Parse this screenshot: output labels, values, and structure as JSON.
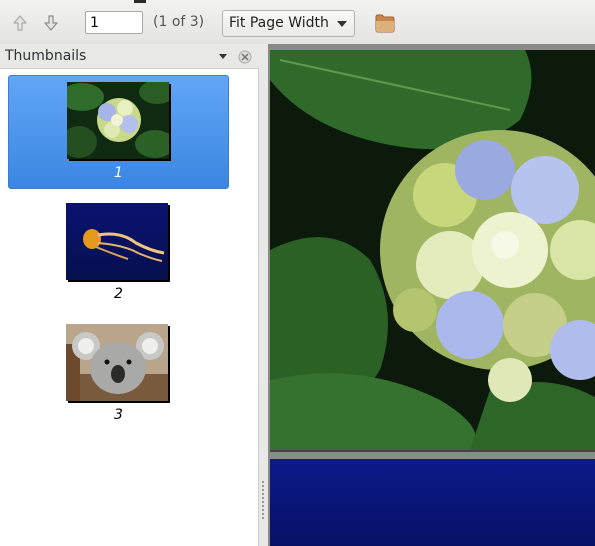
{
  "toolbar": {
    "prev_icon": "arrow-up-icon",
    "next_icon": "arrow-down-icon",
    "page_value": "1",
    "page_count": "(1 of 3)",
    "zoom_selected": "Fit Page Width",
    "folder_icon": "folder-icon"
  },
  "sidebar": {
    "title": "Thumbnails",
    "thumbnails": [
      {
        "label": "1",
        "subject": "blue hydrangea flowers with green leaves",
        "selected": true
      },
      {
        "label": "2",
        "subject": "orange jellyfish on dark blue background",
        "selected": false
      },
      {
        "label": "3",
        "subject": "koala on a tree branch",
        "selected": false
      }
    ]
  },
  "colors": {
    "selection": "#3b86e3",
    "toolbar_bg": "#e8e8e7",
    "viewer_bg": "#8a8a88"
  }
}
